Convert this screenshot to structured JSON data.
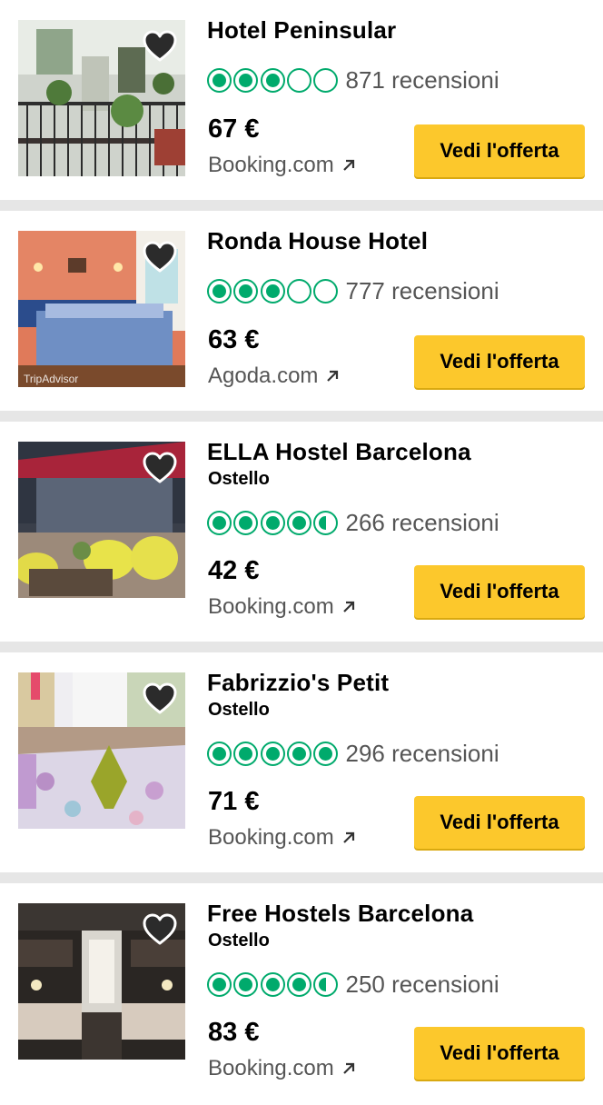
{
  "colors": {
    "rating_green": "#00aa6c",
    "button_yellow": "#fcc82c",
    "background": "#e6e6e6"
  },
  "icons": {
    "save": "heart-icon",
    "external": "external-arrow-icon"
  },
  "hotels": [
    {
      "name": "Hotel Peninsular",
      "type": "",
      "rating": 3,
      "reviews": "871 recensioni",
      "price": "67 €",
      "provider": "Booking.com",
      "button": "Vedi l'offerta",
      "photo_watermark": ""
    },
    {
      "name": "Ronda House Hotel",
      "type": "",
      "rating": 3,
      "reviews": "777 recensioni",
      "price": "63 €",
      "provider": "Agoda.com",
      "button": "Vedi l'offerta",
      "photo_watermark": "TripAdvisor"
    },
    {
      "name": "ELLA Hostel Barcelona",
      "type": "Ostello",
      "rating": 4.5,
      "reviews": "266 recensioni",
      "price": "42 €",
      "provider": "Booking.com",
      "button": "Vedi l'offerta",
      "photo_watermark": ""
    },
    {
      "name": "Fabrizzio's Petit",
      "type": "Ostello",
      "rating": 5,
      "reviews": "296 recensioni",
      "price": "71 €",
      "provider": "Booking.com",
      "button": "Vedi l'offerta",
      "photo_watermark": ""
    },
    {
      "name": "Free Hostels Barcelona",
      "type": "Ostello",
      "rating": 4.5,
      "reviews": "250 recensioni",
      "price": "83 €",
      "provider": "Booking.com",
      "button": "Vedi l'offerta",
      "photo_watermark": ""
    }
  ]
}
